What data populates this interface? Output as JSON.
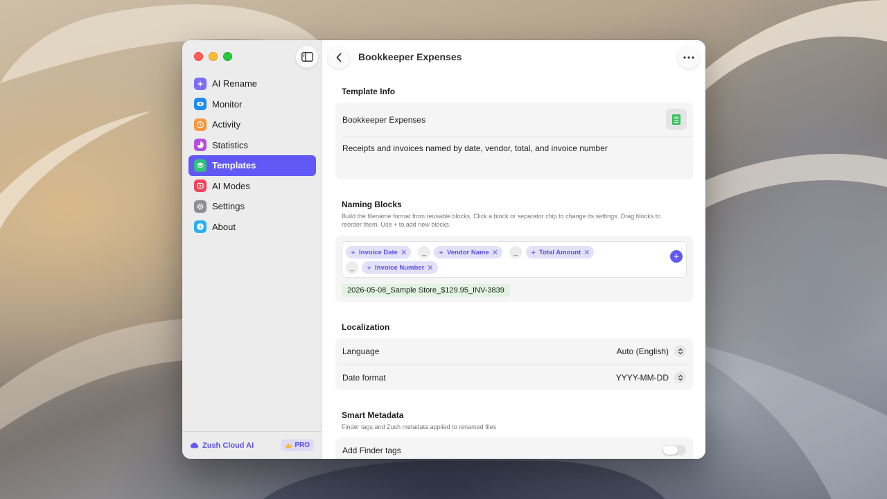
{
  "app": {
    "window_title": "Bookkeeper Expenses"
  },
  "sidebar": {
    "items": [
      {
        "label": "AI Rename",
        "icon": "sparkle-icon",
        "color": "#7c6cf6"
      },
      {
        "label": "Monitor",
        "icon": "eye-icon",
        "color": "#1e8cf0"
      },
      {
        "label": "Activity",
        "icon": "clock-icon",
        "color": "#f7943a"
      },
      {
        "label": "Statistics",
        "icon": "pie-chart-icon",
        "color": "#b54fe0"
      },
      {
        "label": "Templates",
        "icon": "layers-icon",
        "color": "#30c27b",
        "active": true
      },
      {
        "label": "AI Modes",
        "icon": "mode-icon",
        "color": "#f0455d"
      },
      {
        "label": "Settings",
        "icon": "gear-icon",
        "color": "#8e8e93"
      },
      {
        "label": "About",
        "icon": "info-icon",
        "color": "#2ab0f0"
      }
    ],
    "footer": {
      "cloud_label": "Zush Cloud AI",
      "pro_label": "PRO"
    }
  },
  "template_info": {
    "title": "Template Info",
    "name": "Bookkeeper Expenses",
    "description": "Receipts and invoices named by date, vendor, total, and invoice number"
  },
  "naming_blocks": {
    "title": "Naming Blocks",
    "description": "Build the filename format from reusable blocks. Click a block or separator chip to change its settings. Drag blocks to reorder them. Use + to add new blocks.",
    "blocks": [
      "Invoice Date",
      "Vendor Name",
      "Total Amount",
      "Invoice Number"
    ],
    "separator": "_",
    "add_label": "+",
    "preview": "2026-05-08_Sample Store_$129.95_INV-3839"
  },
  "localization": {
    "title": "Localization",
    "language_label": "Language",
    "language_value": "Auto (English)",
    "date_format_label": "Date format",
    "date_format_value": "YYYY-MM-DD"
  },
  "smart_metadata": {
    "title": "Smart Metadata",
    "description": "Finder tags and Zush metadata applied to renamed files",
    "finder_tags_label": "Add Finder tags",
    "finder_tags_enabled": false
  }
}
